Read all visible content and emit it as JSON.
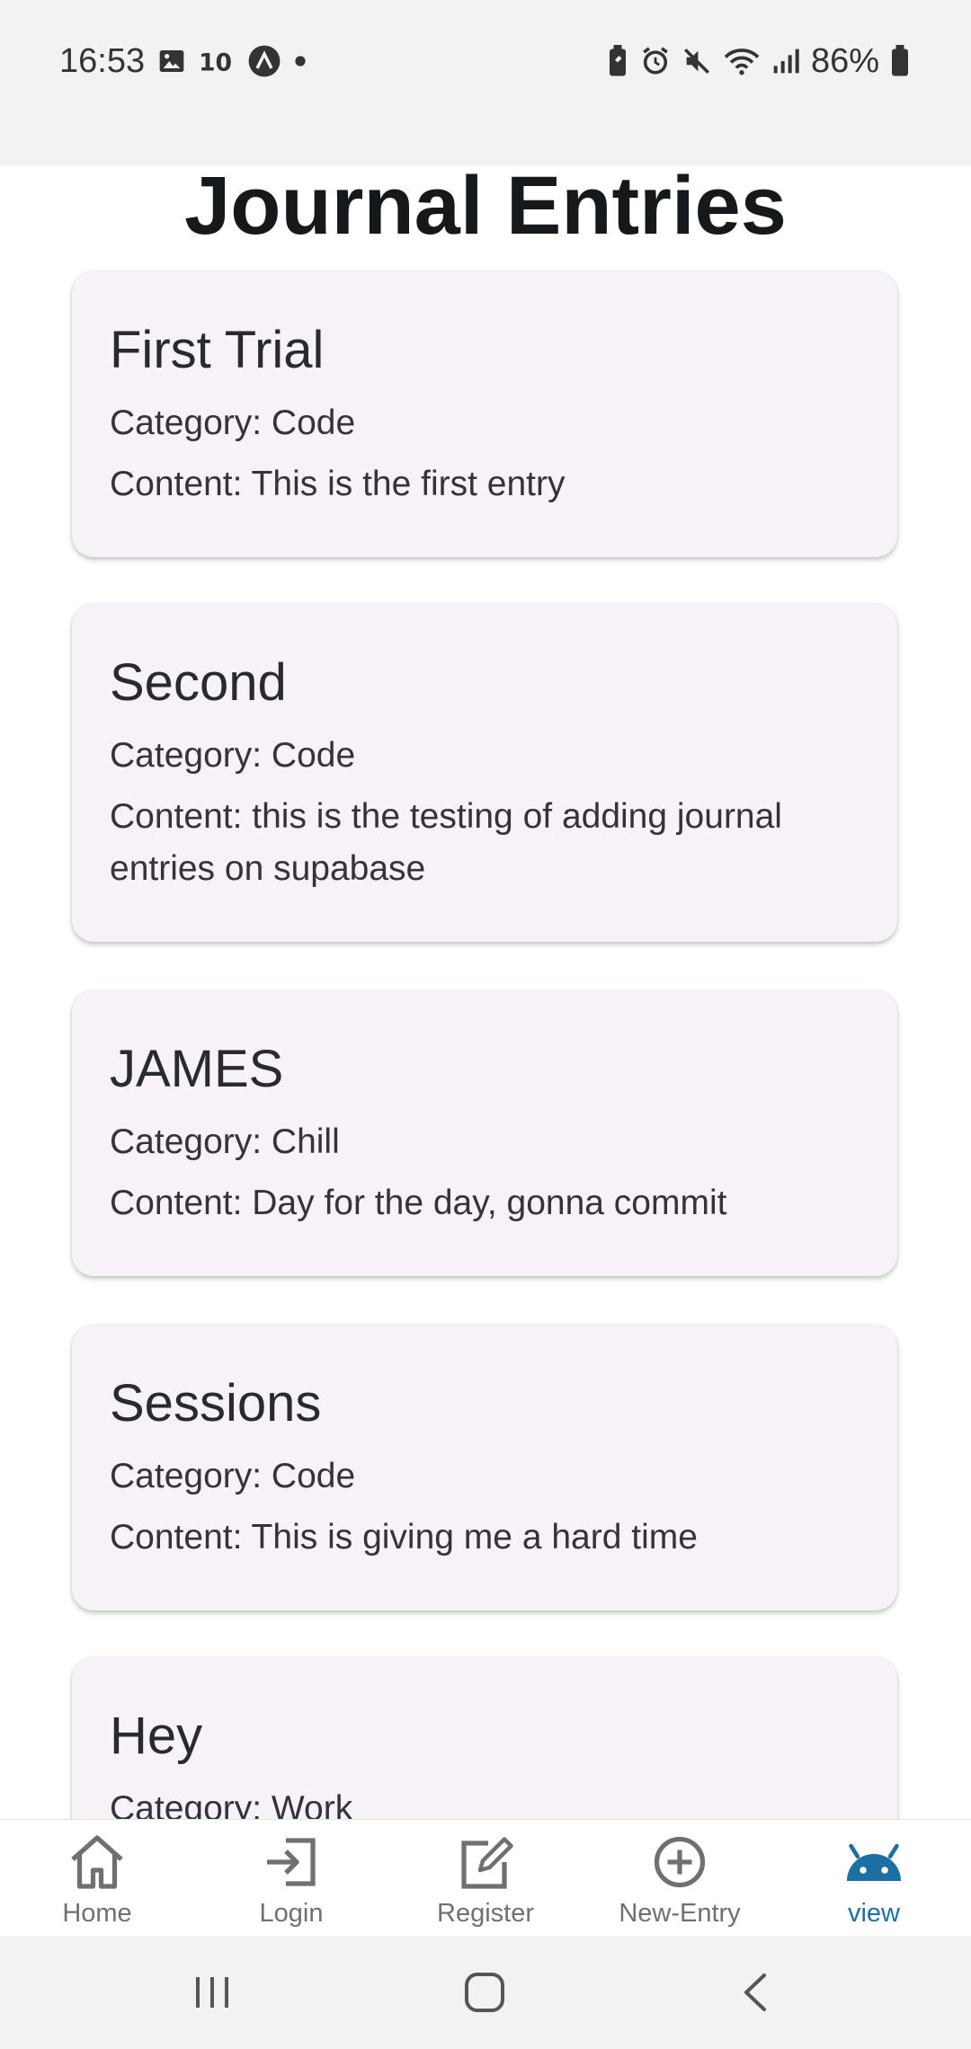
{
  "status_bar": {
    "time": "16:53",
    "left_icons": [
      "image-icon",
      "ten-icon",
      "app-badge-icon",
      "dot-icon"
    ],
    "right_icons": [
      "battery-saver-icon",
      "alarm-icon",
      "mute-icon",
      "wifi-icon",
      "signal-icon"
    ],
    "battery_percent": "86%"
  },
  "page": {
    "title": "Journal Entries"
  },
  "entries": [
    {
      "title": "First Trial",
      "category": "Category: Code",
      "content": "Content: This is the first entry"
    },
    {
      "title": "Second",
      "category": "Category: Code",
      "content": "Content: this is the testing of adding journal entries on supabase"
    },
    {
      "title": "JAMES",
      "category": "Category: Chill",
      "content": "Content: Day for the day, gonna commit"
    },
    {
      "title": "Sessions",
      "category": "Category: Code",
      "content": "Content: This is giving me a hard time"
    },
    {
      "title": "Hey",
      "category": "Category: Work",
      "content": ""
    }
  ],
  "bottom_nav": {
    "items": [
      {
        "label": "Home",
        "icon": "home-icon"
      },
      {
        "label": "Login",
        "icon": "login-icon"
      },
      {
        "label": "Register",
        "icon": "register-icon"
      },
      {
        "label": "New-Entry",
        "icon": "add-circle-icon"
      },
      {
        "label": "view",
        "icon": "android-icon",
        "active": true
      }
    ],
    "active_color": "#1b6fa3"
  },
  "system_nav": [
    "recents-button",
    "home-button",
    "back-button"
  ]
}
